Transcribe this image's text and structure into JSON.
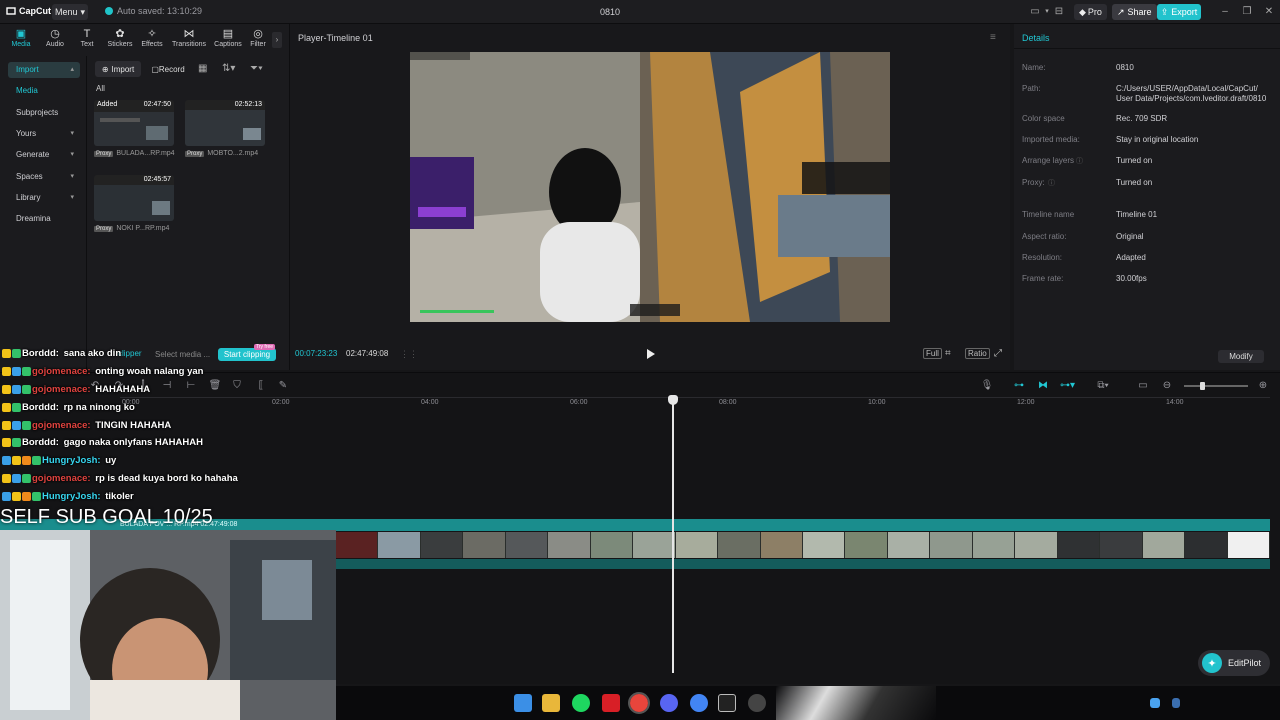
{
  "app": {
    "logo": "CapCut",
    "menu_label": "Menu",
    "autosave": "Auto saved: 13:10:29",
    "window_title": "0810",
    "pro_label": "Pro",
    "share_label": "Share",
    "export_label": "Export",
    "accent": "#22c3cd"
  },
  "toolbar_tabs": [
    {
      "label": "Media",
      "icon": "media-icon",
      "active": true
    },
    {
      "label": "Audio",
      "icon": "audio-icon"
    },
    {
      "label": "Text",
      "icon": "text-icon"
    },
    {
      "label": "Stickers",
      "icon": "stickers-icon"
    },
    {
      "label": "Effects",
      "icon": "effects-icon"
    },
    {
      "label": "Transitions",
      "icon": "transitions-icon"
    },
    {
      "label": "Captions",
      "icon": "captions-icon"
    },
    {
      "label": "Filter",
      "icon": "filters-icon"
    }
  ],
  "sidebar": {
    "items": [
      {
        "label": "Import",
        "selected": true
      },
      {
        "label": "Media"
      },
      {
        "label": "Subprojects"
      },
      {
        "label": "Yours"
      },
      {
        "label": "Generate"
      },
      {
        "label": "Spaces"
      },
      {
        "label": "Library"
      },
      {
        "label": "Dreamina"
      }
    ]
  },
  "media_panel": {
    "import_label": "Import",
    "record_label": "Record",
    "filter_label": "All",
    "items": [
      {
        "badge": "Added",
        "duration": "02:47:50",
        "proxy": "Proxy",
        "name": "BULADA...RP.mp4"
      },
      {
        "badge": "",
        "duration": "02:52:13",
        "proxy": "Proxy",
        "name": "MOBTO...2.mp4"
      },
      {
        "badge": "",
        "duration": "02:45:57",
        "proxy": "Proxy",
        "name": "NOKI P...RP.mp4"
      }
    ]
  },
  "clipper": {
    "label": "clipper",
    "select_media": "Select media ...",
    "start_label": "Start clipping",
    "try_free": "Try free"
  },
  "player": {
    "title": "Player-Timeline 01",
    "current_time": "00:07:23:23",
    "duration": "02:47:49:08",
    "full_label": "Full",
    "ratio_label": "Ratio"
  },
  "details": {
    "title": "Details",
    "rows": [
      {
        "label": "Name:",
        "value": "0810"
      },
      {
        "label": "Path:",
        "value": "C:/Users/USER/AppData/Local/CapCut/ User Data/Projects/com.lveditor.draft/0810"
      },
      {
        "label": "Color space",
        "value": "Rec. 709 SDR"
      },
      {
        "label": "Imported media:",
        "value": "Stay in original location"
      },
      {
        "label": "Arrange layers",
        "value": "Turned on"
      },
      {
        "label": "Proxy:",
        "value": "Turned on"
      },
      {
        "label": "Timeline name",
        "value": "Timeline 01"
      },
      {
        "label": "Aspect ratio:",
        "value": "Original"
      },
      {
        "label": "Resolution:",
        "value": "Adapted"
      },
      {
        "label": "Frame rate:",
        "value": "30.00fps"
      }
    ],
    "modify_label": "Modify"
  },
  "timeline": {
    "ruler": [
      "00:00",
      "02:00",
      "04:00",
      "06:00",
      "08:00",
      "10:00",
      "12:00",
      "14:00"
    ],
    "track_label": "BULADA POV ... RP.mp4  02:47:49:08",
    "editpilot_label": "EditPilot"
  },
  "chat": [
    {
      "user": "Borddd:",
      "msg": "sana ako din",
      "color": "white"
    },
    {
      "user": "gojomenace:",
      "msg": "onting woah nalang yan",
      "color": "red"
    },
    {
      "user": "gojomenace:",
      "msg": "HAHAHAHA",
      "color": "red"
    },
    {
      "user": "Borddd:",
      "msg": "rp na ninong ko",
      "color": "white"
    },
    {
      "user": "gojomenace:",
      "msg": "TINGIN HAHAHA",
      "color": "red"
    },
    {
      "user": "Borddd:",
      "msg": "gago naka onlyfans HAHAHAH",
      "color": "white"
    },
    {
      "user": "HungryJosh:",
      "msg": "uy",
      "color": "cyan"
    },
    {
      "user": "gojomenace:",
      "msg": "rp is dead kuya bord ko hahaha",
      "color": "red"
    },
    {
      "user": "HungryJosh:",
      "msg": "tikoler",
      "color": "cyan"
    }
  ],
  "overlay": {
    "goal": "SELF SUB GOAL 10/25"
  }
}
